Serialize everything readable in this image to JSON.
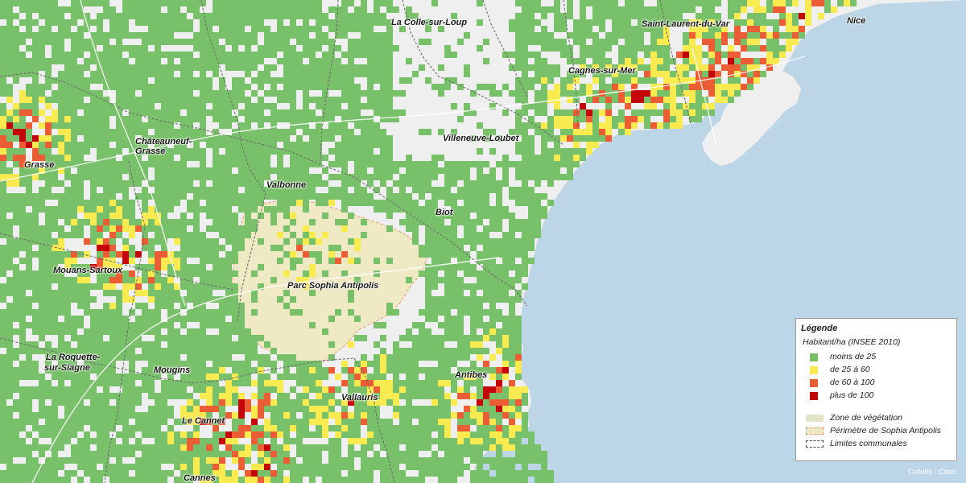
{
  "places": [
    {
      "name": "Nice"
    },
    {
      "name": "La Colle-sur-Loup"
    },
    {
      "name": "Saint-Laurent-du-Var"
    },
    {
      "name": "Cagnes-sur-Mer"
    },
    {
      "name": "Villeneuve-Loubet"
    },
    {
      "name": "Châteauneuf-"
    },
    {
      "name": "Grasse"
    },
    {
      "name": "Grasse"
    },
    {
      "name": "Valbonne"
    },
    {
      "name": "Biot"
    },
    {
      "name": "Mouans-Sartoux"
    },
    {
      "name": "Parc Sophia Antipolis"
    },
    {
      "name": "La Roquette-"
    },
    {
      "name": "sur-Siagne"
    },
    {
      "name": "Mougins"
    },
    {
      "name": "Antibes"
    },
    {
      "name": "Vallauris"
    },
    {
      "name": "Le Cannet"
    },
    {
      "name": "Cannes"
    }
  ],
  "legend": {
    "title": "Légende",
    "subtitle": "Habitant/ha (INSEE 2010)",
    "density_classes": [
      {
        "label": "moins de 25",
        "color": "#79c06a"
      },
      {
        "label": "de 25 à 60",
        "color": "#f6ea50"
      },
      {
        "label": "de 60 à 100",
        "color": "#ea5c33"
      },
      {
        "label": "plus de 100",
        "color": "#c4060c"
      }
    ],
    "other_items": [
      {
        "label": "Zone de végétation",
        "color": "#e4e4cc"
      },
      {
        "label": "Périmètre de Sophia Antipolis",
        "color": "#e8987a"
      },
      {
        "label": "Limites communales",
        "color": "#555555"
      }
    ]
  },
  "credits": "Crédits : Citec",
  "colors": {
    "sea": "#bcd6e8",
    "land": "#efefef",
    "sophia_zone": "#eee9c3"
  }
}
